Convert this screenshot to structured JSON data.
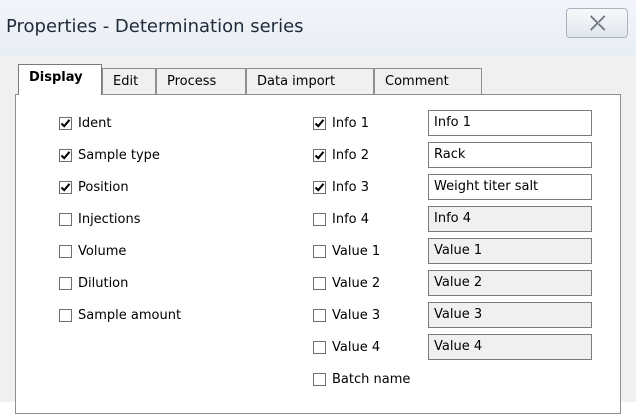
{
  "window": {
    "title": "Properties - Determination series"
  },
  "tabs": [
    {
      "label": "Display",
      "active": true
    },
    {
      "label": "Edit",
      "active": false
    },
    {
      "label": "Process",
      "active": false
    },
    {
      "label": "Data import",
      "active": false
    },
    {
      "label": "Comment",
      "active": false
    }
  ],
  "display": {
    "left_options": [
      {
        "label": "Ident",
        "checked": true
      },
      {
        "label": "Sample type",
        "checked": true
      },
      {
        "label": "Position",
        "checked": true
      },
      {
        "label": "Injections",
        "checked": false
      },
      {
        "label": "Volume",
        "checked": false
      },
      {
        "label": "Dilution",
        "checked": false
      },
      {
        "label": "Sample amount",
        "checked": false
      }
    ],
    "right_options": [
      {
        "label": "Info 1",
        "checked": true,
        "value": "Info 1"
      },
      {
        "label": "Info 2",
        "checked": true,
        "value": "Rack"
      },
      {
        "label": "Info 3",
        "checked": true,
        "value": "Weight titer salt"
      },
      {
        "label": "Info 4",
        "checked": false,
        "value": "Info 4"
      },
      {
        "label": "Value 1",
        "checked": false,
        "value": "Value 1"
      },
      {
        "label": "Value 2",
        "checked": false,
        "value": "Value 2"
      },
      {
        "label": "Value 3",
        "checked": false,
        "value": "Value 3"
      },
      {
        "label": "Value 4",
        "checked": false,
        "value": "Value 4"
      },
      {
        "label": "Batch name",
        "checked": false
      }
    ]
  },
  "icons": {
    "close": "close-icon",
    "check": "checkmark-icon"
  }
}
